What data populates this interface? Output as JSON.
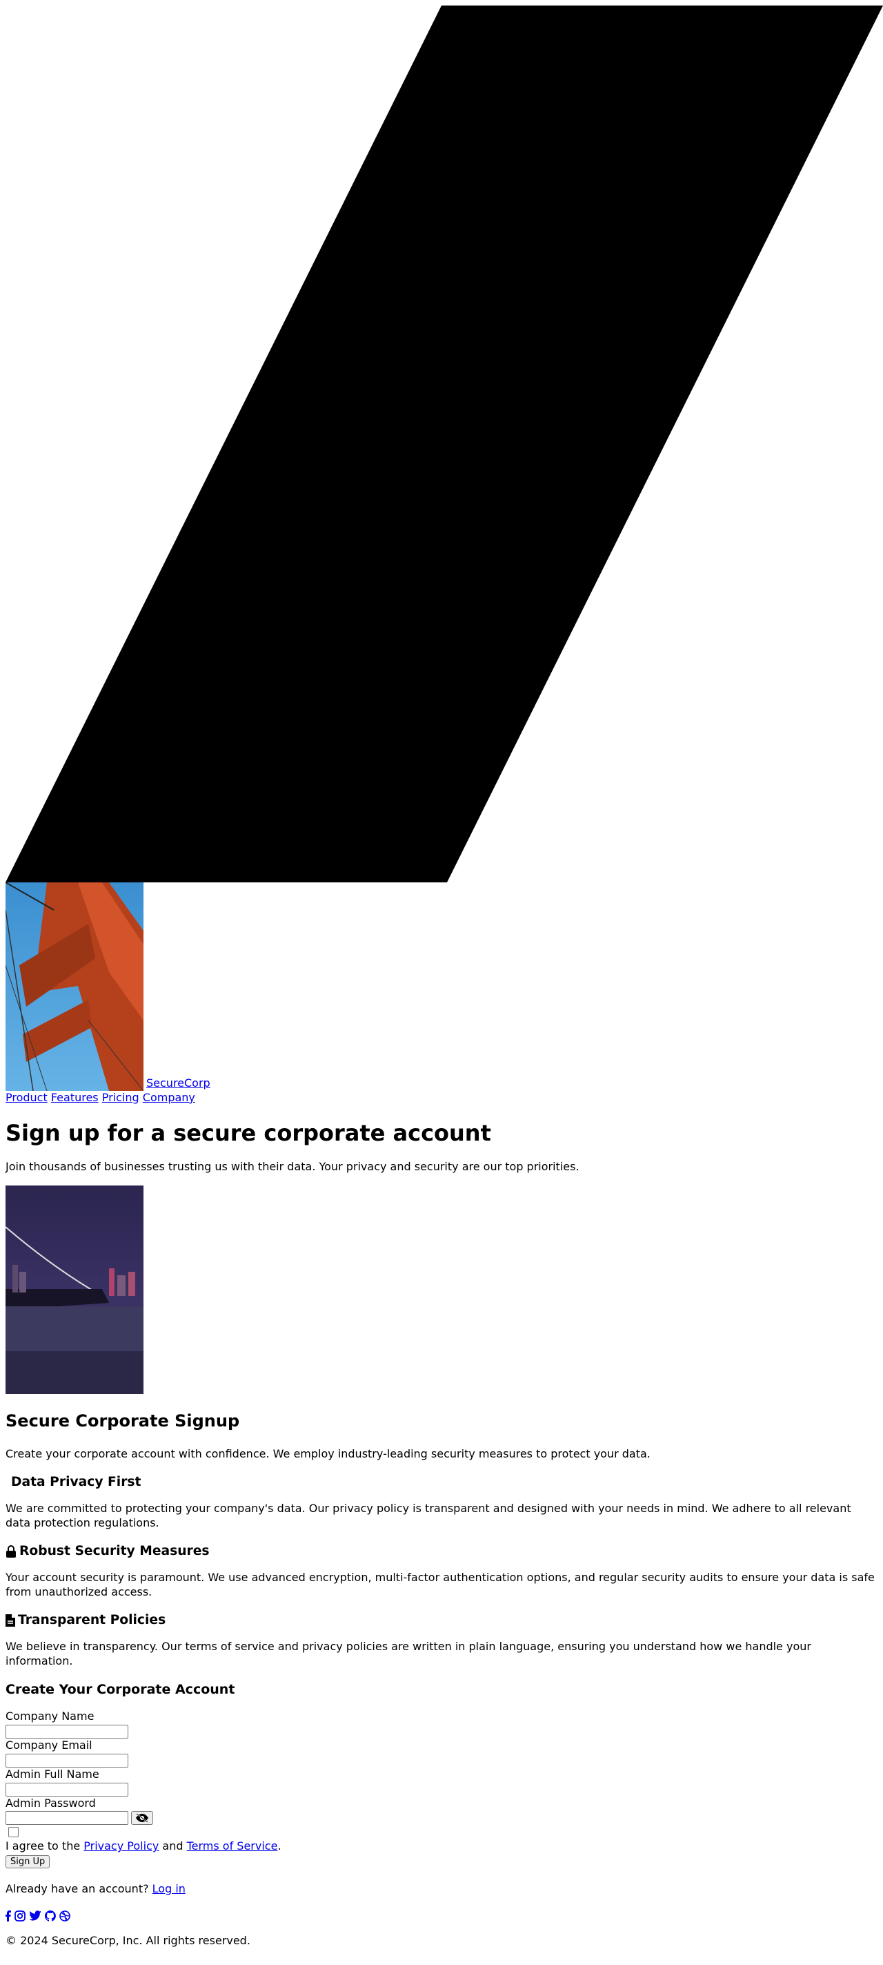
{
  "header": {
    "brand": "SecureCorp",
    "nav": [
      "Product",
      "Features",
      "Pricing",
      "Company"
    ]
  },
  "hero": {
    "title": "Sign up for a secure corporate account",
    "subtitle": "Join thousands of businesses trusting us with their data. Your privacy and security are our top priorities."
  },
  "section": {
    "title": "Secure Corporate Signup",
    "intro": "Create your corporate account with confidence. We employ industry-leading security measures to protect your data.",
    "features": [
      {
        "icon": "shield-icon",
        "title": "Data Privacy First",
        "text": "We are committed to protecting your company's data. Our privacy policy is transparent and designed with your needs in mind. We adhere to all relevant data protection regulations."
      },
      {
        "icon": "lock-icon",
        "title": "Robust Security Measures",
        "text": "Your account security is paramount. We use advanced encryption, multi-factor authentication options, and regular security audits to ensure your data is safe from unauthorized access."
      },
      {
        "icon": "document-icon",
        "title": "Transparent Policies",
        "text": "We believe in transparency. Our terms of service and privacy policies are written in plain language, ensuring you understand how we handle your information."
      }
    ]
  },
  "form": {
    "title": "Create Your Corporate Account",
    "company_name_label": "Company Name",
    "company_name_value": "",
    "company_email_label": "Company Email",
    "company_email_value": "",
    "admin_name_label": "Admin Full Name",
    "admin_name_value": "",
    "admin_password_label": "Admin Password",
    "admin_password_value": "",
    "agree_prefix": "I agree to the ",
    "privacy_link": "Privacy Policy",
    "agree_and": " and ",
    "terms_link": "Terms of Service",
    "agree_suffix": ".",
    "submit_label": "Sign Up",
    "login_prompt": "Already have an account? ",
    "login_link": "Log in"
  },
  "footer": {
    "social_icons": [
      "facebook-icon",
      "instagram-icon",
      "twitter-icon",
      "github-icon",
      "dribbble-icon"
    ],
    "copyright": "© 2024 SecureCorp, Inc. All rights reserved."
  },
  "colors": {
    "link": "#0000ee",
    "shape": "#000000",
    "sky": "#4a9bd8",
    "bridge": "#c2461f",
    "night": "#2a2548"
  }
}
